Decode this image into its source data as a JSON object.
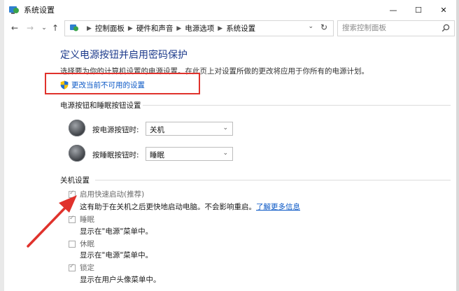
{
  "window": {
    "title": "系统设置",
    "minimize": "—",
    "maximize": "☐",
    "close": "✕"
  },
  "nav": {
    "back": "←",
    "forward": "→",
    "recent": "⌄",
    "up": "↑"
  },
  "address": {
    "crumbs": [
      "控制面板",
      "硬件和声音",
      "电源选项",
      "系统设置"
    ],
    "dropdown": "⌄",
    "refresh": "↻"
  },
  "search": {
    "placeholder": "搜索控制面板"
  },
  "page": {
    "title": "定义电源按钮并启用密码保护",
    "description": "选择要为你的计算机设置的电源设置。在此页上对设置所做的更改将应用于你所有的电源计划。",
    "change_link": "更改当前不可用的设置"
  },
  "power_buttons": {
    "heading": "电源按钮和睡眠按钮设置",
    "rows": [
      {
        "label": "按电源按钮时:",
        "value": "关机"
      },
      {
        "label": "按睡眠按钮时:",
        "value": "睡眠"
      }
    ]
  },
  "shutdown": {
    "heading": "关机设置",
    "items": [
      {
        "label": "启用快速启动(推荐)",
        "checked": true,
        "desc": "这有助于在关机之后更快地启动电脑。不会影响重启。",
        "link": "了解更多信息"
      },
      {
        "label": "睡眠",
        "checked": true,
        "desc": "显示在\"电源\"菜单中。"
      },
      {
        "label": "休眠",
        "checked": false,
        "desc": "显示在\"电源\"菜单中。"
      },
      {
        "label": "锁定",
        "checked": true,
        "desc": "显示在用户头像菜单中。"
      }
    ]
  },
  "colors": {
    "title_blue": "#1d3b8c",
    "link_blue": "#0b58c6",
    "annotation_red": "#e0322c"
  }
}
